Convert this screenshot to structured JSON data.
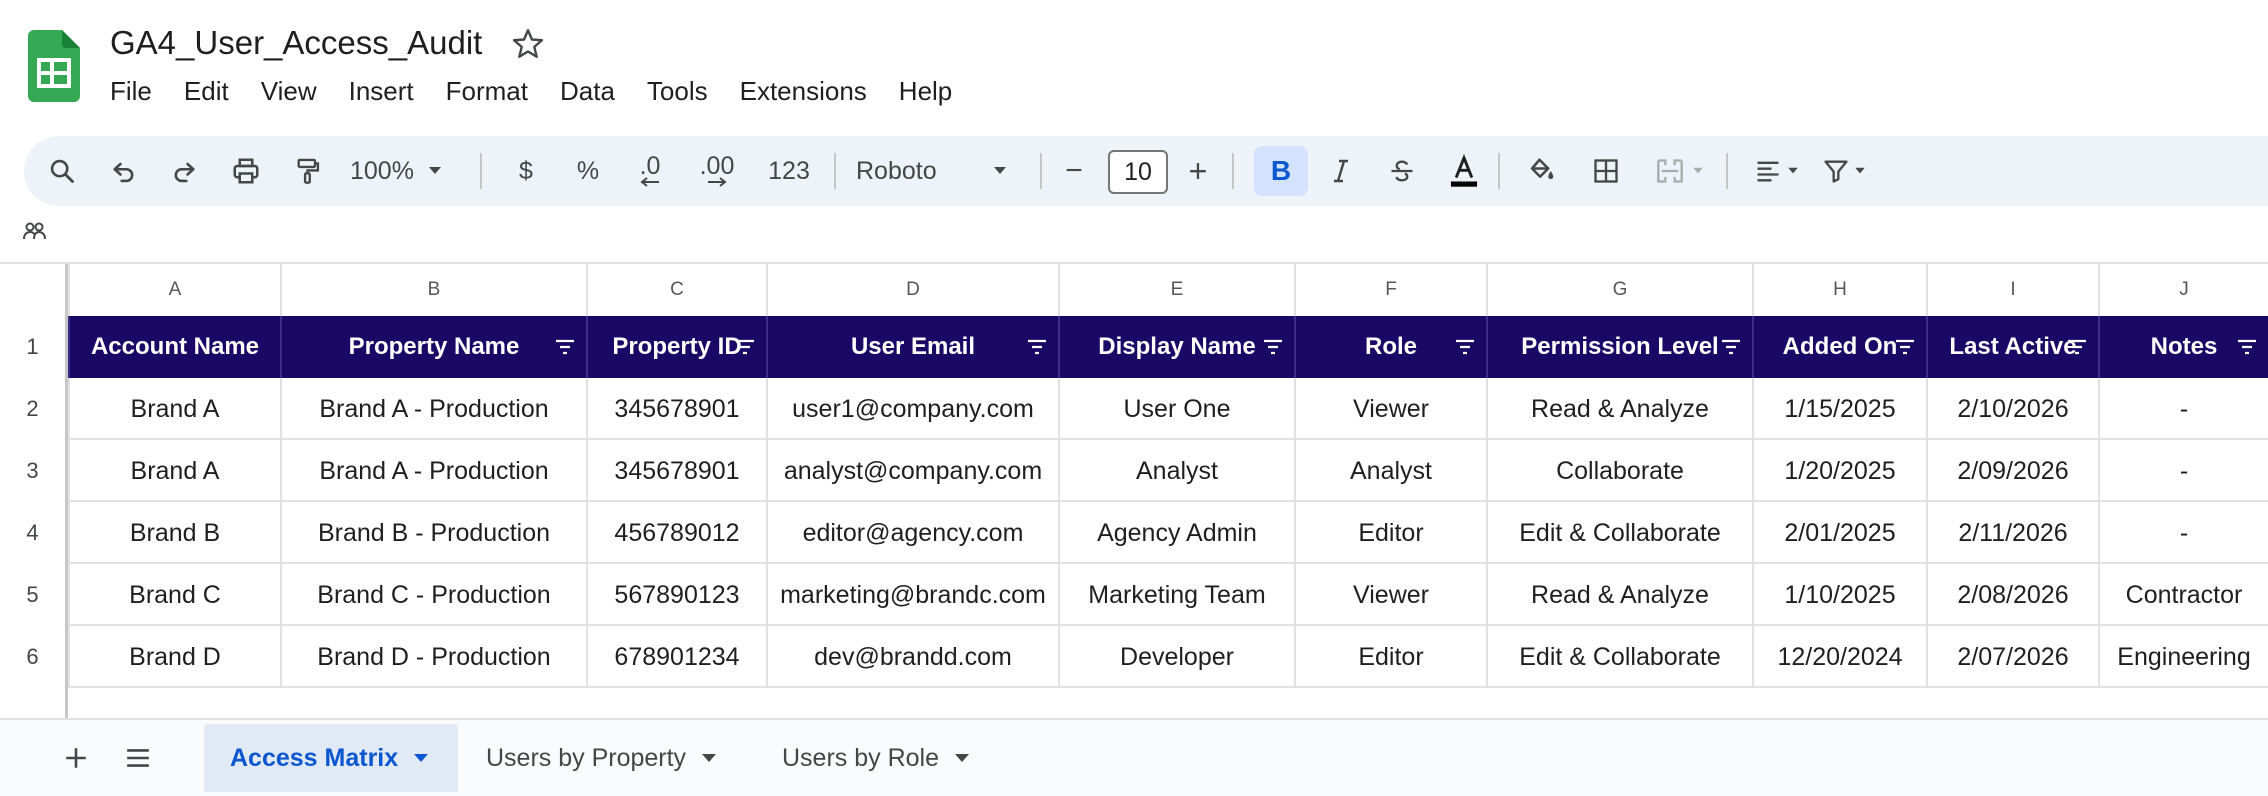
{
  "doc": {
    "title": "GA4_User_Access_Audit"
  },
  "menu": [
    "File",
    "Edit",
    "View",
    "Insert",
    "Format",
    "Data",
    "Tools",
    "Extensions",
    "Help"
  ],
  "toolbar": {
    "zoom": "100%",
    "currency": "$",
    "percent": "%",
    "decrease_decimal": ".0",
    "increase_decimal": ".00",
    "number_format": "123",
    "font": "Roboto",
    "minus": "−",
    "font_size": "10",
    "plus": "+",
    "bold": "B"
  },
  "columns": [
    "A",
    "B",
    "C",
    "D",
    "E",
    "F",
    "G",
    "H",
    "I",
    "J"
  ],
  "headers": [
    "Account Name",
    "Property Name",
    "Property ID",
    "User Email",
    "Display Name",
    "Role",
    "Permission Level",
    "Added On",
    "Last Active",
    "Notes"
  ],
  "rows": [
    {
      "num": "2",
      "cells": [
        "Brand A",
        "Brand A - Production",
        "345678901",
        "user1@company.com",
        "User One",
        "Viewer",
        "Read & Analyze",
        "1/15/2025",
        "2/10/2026",
        "-"
      ]
    },
    {
      "num": "3",
      "cells": [
        "Brand A",
        "Brand A - Production",
        "345678901",
        "analyst@company.com",
        "Analyst",
        "Analyst",
        "Collaborate",
        "1/20/2025",
        "2/09/2026",
        "-"
      ]
    },
    {
      "num": "4",
      "cells": [
        "Brand B",
        "Brand B - Production",
        "456789012",
        "editor@agency.com",
        "Agency Admin",
        "Editor",
        "Edit & Collaborate",
        "2/01/2025",
        "2/11/2026",
        "-"
      ]
    },
    {
      "num": "5",
      "cells": [
        "Brand C",
        "Brand C - Production",
        "567890123",
        "marketing@brandc.com",
        "Marketing Team",
        "Viewer",
        "Read & Analyze",
        "1/10/2025",
        "2/08/2026",
        "Contractor"
      ]
    },
    {
      "num": "6",
      "cells": [
        "Brand D",
        "Brand D - Production",
        "678901234",
        "dev@brandd.com",
        "Developer",
        "Editor",
        "Edit & Collaborate",
        "12/20/2024",
        "2/07/2026",
        "Engineering"
      ]
    }
  ],
  "header_row_num": "1",
  "sheets": [
    {
      "label": "Access Matrix",
      "active": true
    },
    {
      "label": "Users by Property",
      "active": false
    },
    {
      "label": "Users by Role",
      "active": false
    }
  ],
  "colors": {
    "header_bg": "#1a0866",
    "accent": "#0b57d0"
  }
}
